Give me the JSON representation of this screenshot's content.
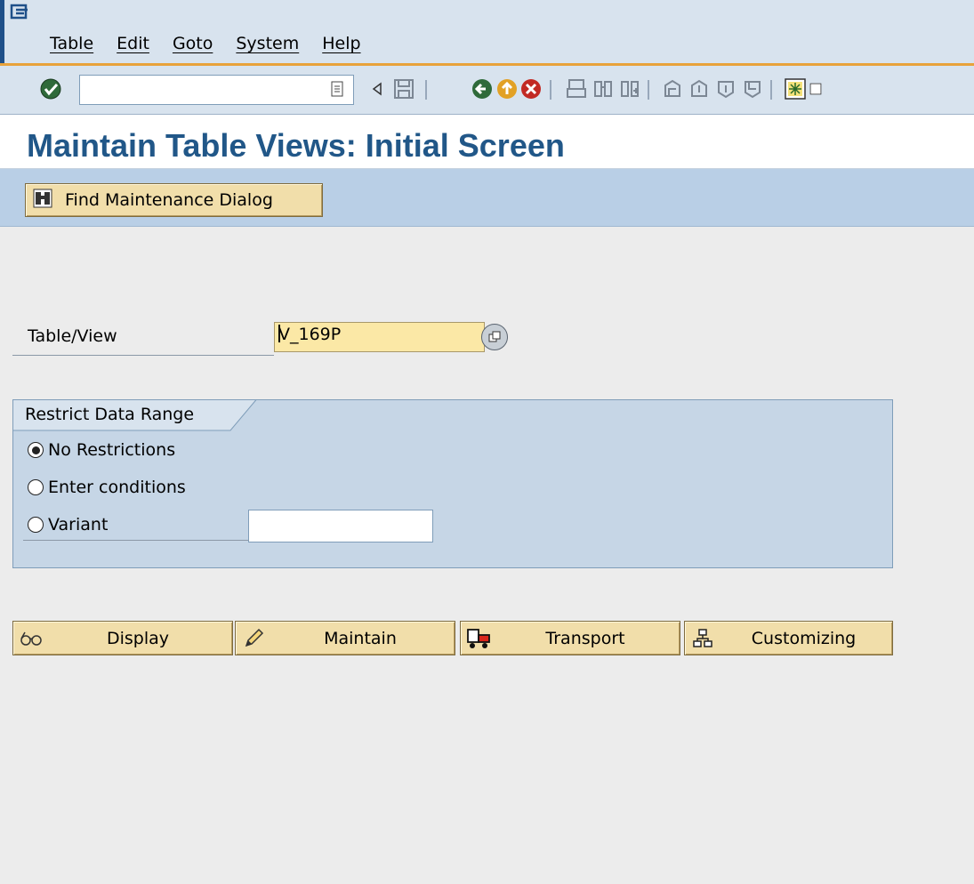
{
  "menu": {
    "items": [
      "Table",
      "Edit",
      "Goto",
      "System",
      "Help"
    ]
  },
  "toolbar": {
    "command_field_value": "",
    "icons": [
      "enter-icon",
      "command-dropdown-icon",
      "back-arrow-icon",
      "save-icon",
      "back-icon",
      "exit-icon",
      "cancel-icon",
      "print-icon",
      "find-icon",
      "find-next-icon",
      "first-page-icon",
      "previous-page-icon",
      "next-page-icon",
      "last-page-icon",
      "create-session-icon"
    ]
  },
  "title": "Maintain Table Views: Initial Screen",
  "app_toolbar": {
    "find_button_label": "Find Maintenance Dialog"
  },
  "form": {
    "table_view_label": "Table/View",
    "table_view_value": "V_169P"
  },
  "restrict": {
    "group_title": "Restrict Data Range",
    "options": [
      {
        "label": "No Restrictions",
        "selected": true
      },
      {
        "label": "Enter conditions",
        "selected": false
      },
      {
        "label": "Variant",
        "selected": false
      }
    ],
    "variant_value": ""
  },
  "actions": {
    "display_label": "Display",
    "maintain_label": "Maintain",
    "transport_label": "Transport",
    "customizing_label": "Customizing"
  },
  "colors": {
    "title": "#215788",
    "button_face": "#f1deaa",
    "input_required": "#fbe8a6",
    "group_box": "#c6d6e6",
    "toolbar": "#d8e3ee",
    "accent_line": "#e8a23a"
  }
}
